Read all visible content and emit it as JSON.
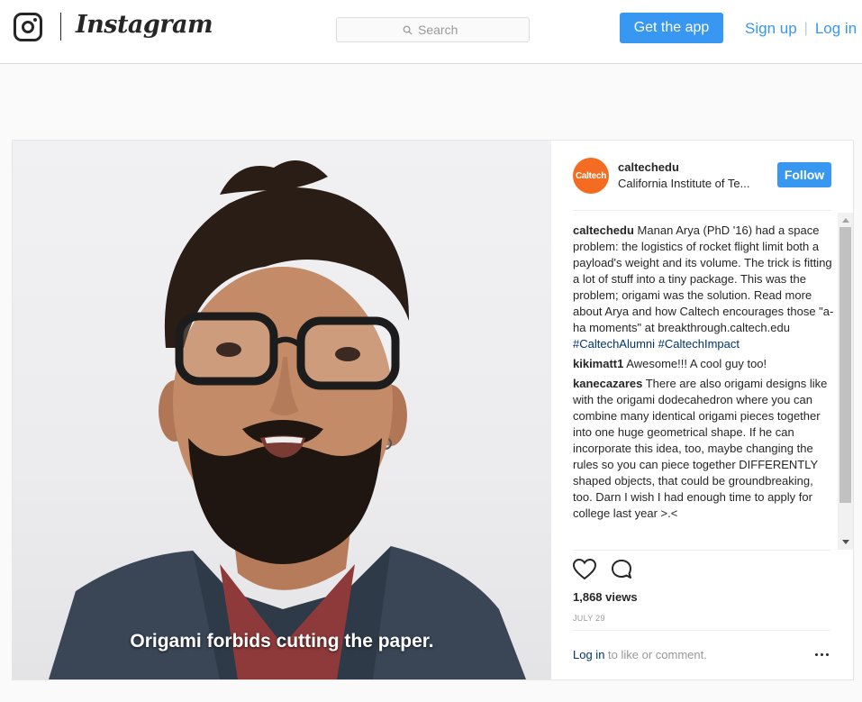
{
  "nav": {
    "brand": "Instagram",
    "search_placeholder": "Search",
    "get_app_label": "Get the app",
    "sign_up_label": "Sign up",
    "separator": "|",
    "log_in_label": "Log in"
  },
  "post": {
    "video_caption": "Origami forbids cutting the paper.",
    "avatar_text": "Caltech",
    "avatar_color": "#f36c21",
    "username": "caltechedu",
    "location": "California Institute of Te...",
    "follow_label": "Follow",
    "comments": [
      {
        "user": "caltechedu",
        "text": "Manan Arya (PhD '16) had a space problem: the logistics of rocket flight limit both a payload's weight and its volume. The trick is fitting a lot of stuff into a tiny package. This was the problem; origami was the solution. Read more about Arya and how Caltech encourages those \"a-ha moments\" at breakthrough.caltech.edu",
        "hashtags": "#CaltechAlumni #CaltechImpact"
      },
      {
        "user": "kikimatt1",
        "text": "Awesome!!! A cool guy too!"
      },
      {
        "user": "kanecazares",
        "text": "There are also origami designs like with the origami dodecahedron where you can combine many identical origami pieces together into one huge geometrical shape. If he can incorporate this idea, too, maybe changing the rules so you can piece together DIFFERENTLY shaped objects, that could be groundbreaking, too. Darn I wish I had enough time to apply for college last year >.<"
      }
    ],
    "views": "1,868 views",
    "date": "JULY 29",
    "login_link": "Log in",
    "login_suffix": " to like or comment."
  },
  "colors": {
    "accent": "#3897f0",
    "hashtag": "#003569"
  }
}
